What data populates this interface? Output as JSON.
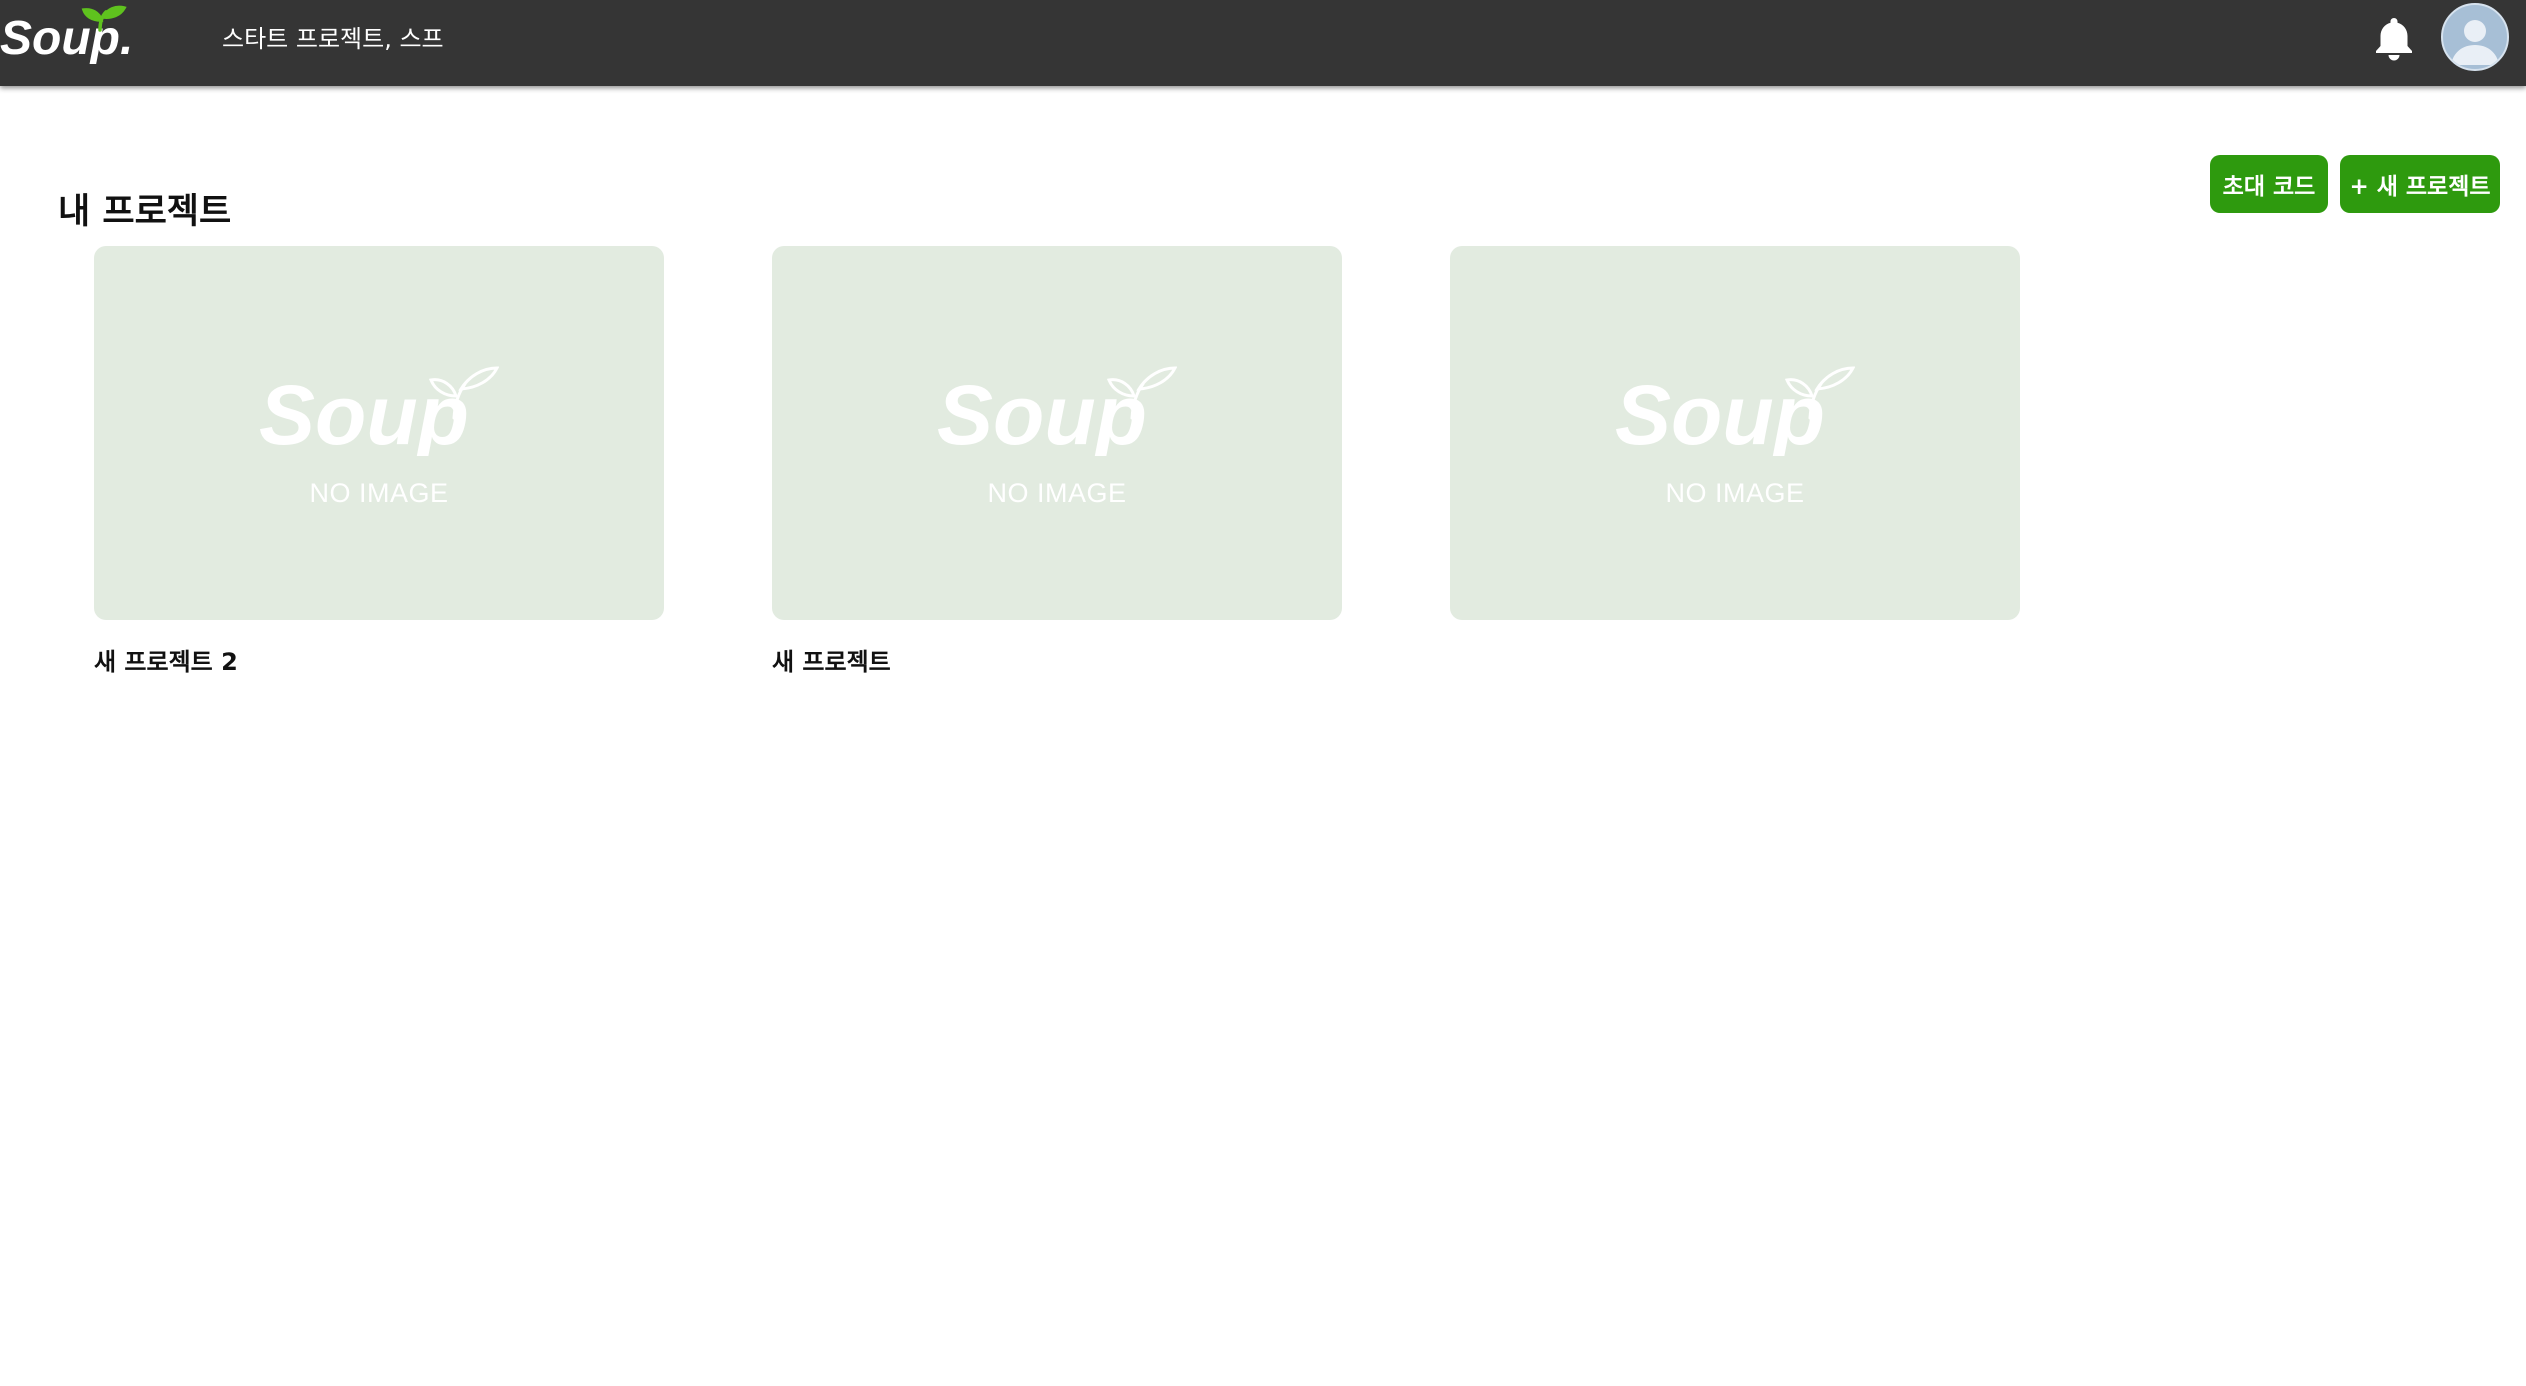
{
  "header": {
    "logo_text": "Soup.",
    "tagline": "스타트 프로젝트, 스프",
    "bell_icon": "bell-icon",
    "avatar_icon": "user-avatar-icon"
  },
  "main": {
    "title": "내 프로젝트",
    "invite_button_label": "초대 코드",
    "new_project_button_label": "+ 새 프로젝트"
  },
  "projects": [
    {
      "title": "새 프로젝트 2",
      "placeholder_logo": "Soup",
      "placeholder_text": "NO IMAGE"
    },
    {
      "title": "새 프로젝트",
      "placeholder_logo": "Soup",
      "placeholder_text": "NO IMAGE"
    },
    {
      "title": "",
      "placeholder_logo": "Soup",
      "placeholder_text": "NO IMAGE"
    }
  ],
  "colors": {
    "header_bg": "#353535",
    "accent_green": "#2e9a0e",
    "leaf_green": "#5fc21e",
    "thumb_bg": "#e2ebe0"
  }
}
